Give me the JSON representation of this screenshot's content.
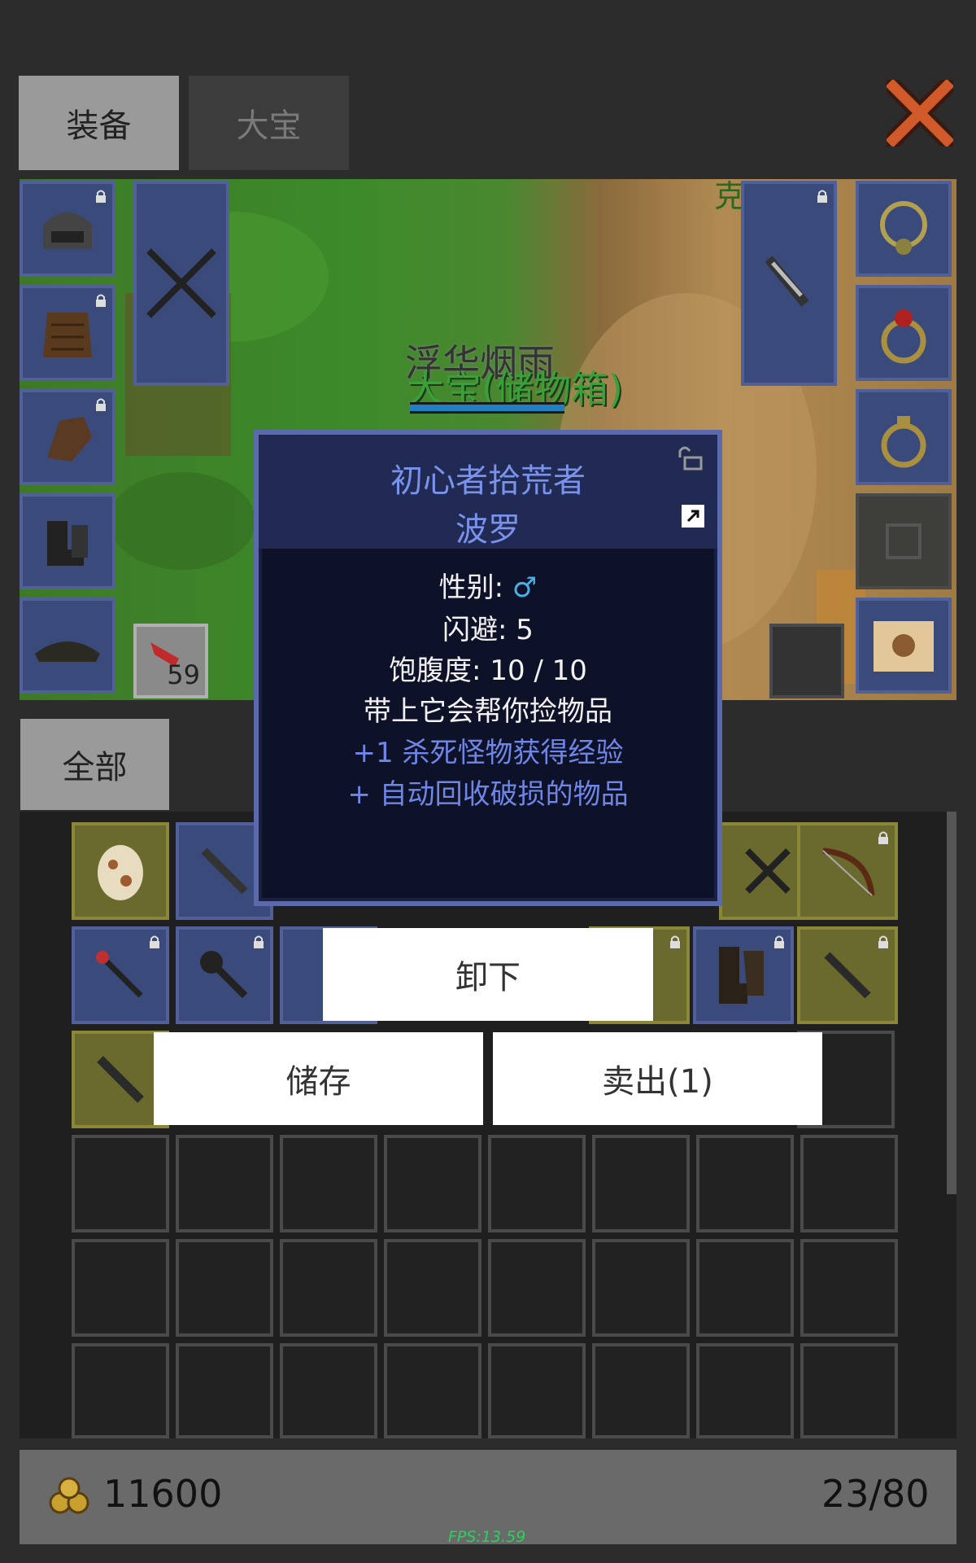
{
  "tabs": [
    {
      "label": "装备",
      "active": true
    },
    {
      "label": "大宝",
      "active": false
    }
  ],
  "scene": {
    "overlay_name": "浮华烟雨",
    "pet_name": "大宝(储物箱)",
    "top_partial_text": "克"
  },
  "quick_slot": {
    "count": "59"
  },
  "filter_tab": {
    "label": "全部"
  },
  "tooltip": {
    "title_line1": "初心者拾荒者",
    "title_line2": "波罗",
    "gender_label": "性别:",
    "gender_symbol": "♂",
    "dodge": "闪避: 5",
    "satiety": "饱腹度: 10 / 10",
    "desc": "带上它会帮你捡物品",
    "bonus1": "+1 杀死怪物获得经验",
    "bonus2": "+ 自动回收破损的物品"
  },
  "actions": {
    "unequip": "卸下",
    "store": "储存",
    "sell": "卖出(1)"
  },
  "footer": {
    "gold": "11600",
    "capacity": "23/80",
    "fps": "FPS:13.59"
  },
  "colors": {
    "accent_blue": "#6f86e6",
    "fps_green": "#27d35a",
    "slot_blue": "#3a4a7a",
    "slot_gold": "#6a6a2e"
  }
}
